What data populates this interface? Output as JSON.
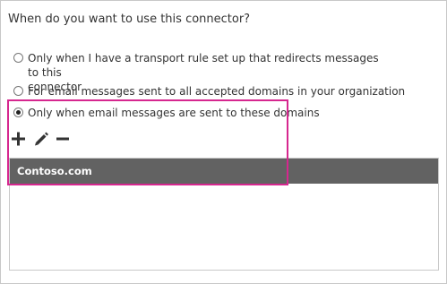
{
  "dialog": {
    "heading": "When do you want to use this connector?"
  },
  "options": [
    {
      "label_line1": "Only when I have a transport rule set up that redirects messages to this",
      "label_line2": "connector",
      "checked": false
    },
    {
      "label": "For email messages sent to all accepted domains in your organization",
      "checked": false
    },
    {
      "label": "Only when email messages are sent to these domains",
      "checked": true
    }
  ],
  "toolbar": {
    "add_icon": "plus-icon",
    "edit_icon": "pencil-icon",
    "remove_icon": "minus-icon"
  },
  "domains": [
    "Contoso.com"
  ],
  "colors": {
    "highlight": "#d6278f",
    "selected_row": "#626262",
    "icon": "#333333"
  }
}
